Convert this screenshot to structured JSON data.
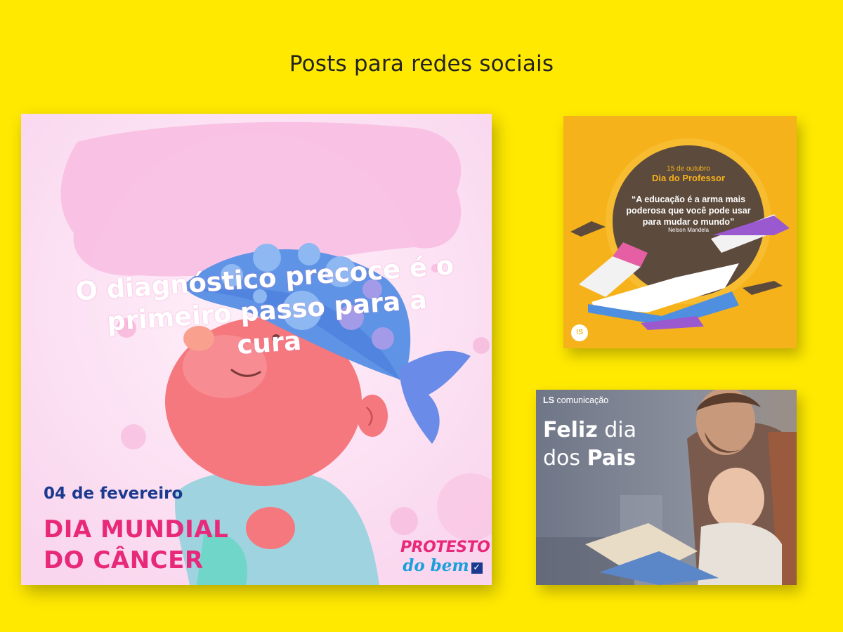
{
  "page": {
    "title": "Posts para redes sociais",
    "background_color": "#FFE900"
  },
  "posts": {
    "cancer_day": {
      "headline": "O diagnóstico precoce é o primeiro passo para a cura",
      "date": "04 de fevereiro",
      "event_line1": "DIA MUNDIAL",
      "event_line2": "DO CÂNCER",
      "logo_line1": "PROTESTO",
      "logo_line2": "do bem",
      "logo_check_icon": "checkbox-icon",
      "accent_pink": "#e8297a",
      "accent_blue": "#1b3a8f"
    },
    "teacher_day": {
      "date": "15 de outubro",
      "title": "Dia do Professor",
      "quote": "“A educação é a arma mais poderosa que você pode usar para mudar o mundo”",
      "author": "Nelson Mandela",
      "logo": "!S",
      "background_color": "#F6B21B"
    },
    "fathers_day": {
      "brand_bold": "LS",
      "brand_rest": " comunicação",
      "headline_bold1": "Feliz",
      "headline_rest1": " dia",
      "headline_rest2": "dos ",
      "headline_bold2": "Pais"
    }
  }
}
